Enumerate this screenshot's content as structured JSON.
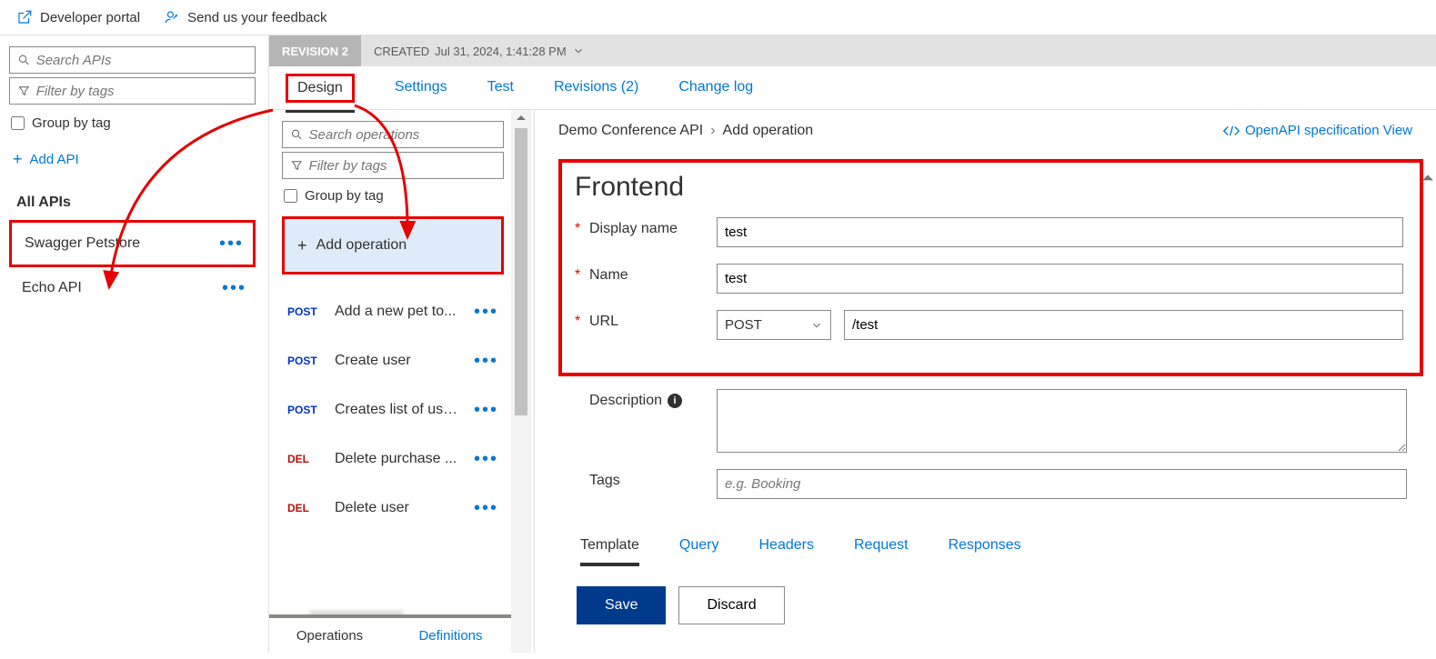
{
  "topbar": {
    "devportal": "Developer portal",
    "feedback": "Send us your feedback"
  },
  "sidebar": {
    "search_placeholder": "Search APIs",
    "filter_placeholder": "Filter by tags",
    "group_by_tag": "Group by tag",
    "add_api": "Add API",
    "all_apis": "All APIs",
    "apis": [
      {
        "name": "Swagger Petstore"
      },
      {
        "name": "Echo API"
      }
    ]
  },
  "revision": {
    "label": "REVISION 2",
    "created_prefix": "CREATED",
    "created_value": "Jul 31, 2024, 1:41:28 PM"
  },
  "tabs": {
    "design": "Design",
    "settings": "Settings",
    "test": "Test",
    "revisions": "Revisions (2)",
    "changelog": "Change log"
  },
  "ops": {
    "search_placeholder": "Search operations",
    "filter_placeholder": "Filter by tags",
    "group_by_tag": "Group by tag",
    "add_operation": "Add operation",
    "items": [
      {
        "method": "POST",
        "method_class": "m-post",
        "name": "Add a new pet to..."
      },
      {
        "method": "POST",
        "method_class": "m-post",
        "name": "Create user"
      },
      {
        "method": "POST",
        "method_class": "m-post",
        "name": "Creates list of use..."
      },
      {
        "method": "DEL",
        "method_class": "m-del",
        "name": "Delete purchase ..."
      },
      {
        "method": "DEL",
        "method_class": "m-del",
        "name": "Delete user"
      }
    ],
    "bottom_tabs": {
      "operations": "Operations",
      "definitions": "Definitions"
    }
  },
  "details": {
    "breadcrumb_api": "Demo Conference API",
    "breadcrumb_page": "Add operation",
    "openapi_link": "OpenAPI specification View",
    "frontend_title": "Frontend",
    "labels": {
      "display_name": "Display name",
      "name": "Name",
      "url": "URL",
      "description": "Description",
      "tags": "Tags"
    },
    "values": {
      "display_name": "test",
      "name": "test",
      "url_method": "POST",
      "url_path": "/test"
    },
    "tags_placeholder": "e.g. Booking",
    "subtabs": {
      "template": "Template",
      "query": "Query",
      "headers": "Headers",
      "request": "Request",
      "responses": "Responses"
    },
    "buttons": {
      "save": "Save",
      "discard": "Discard"
    }
  }
}
